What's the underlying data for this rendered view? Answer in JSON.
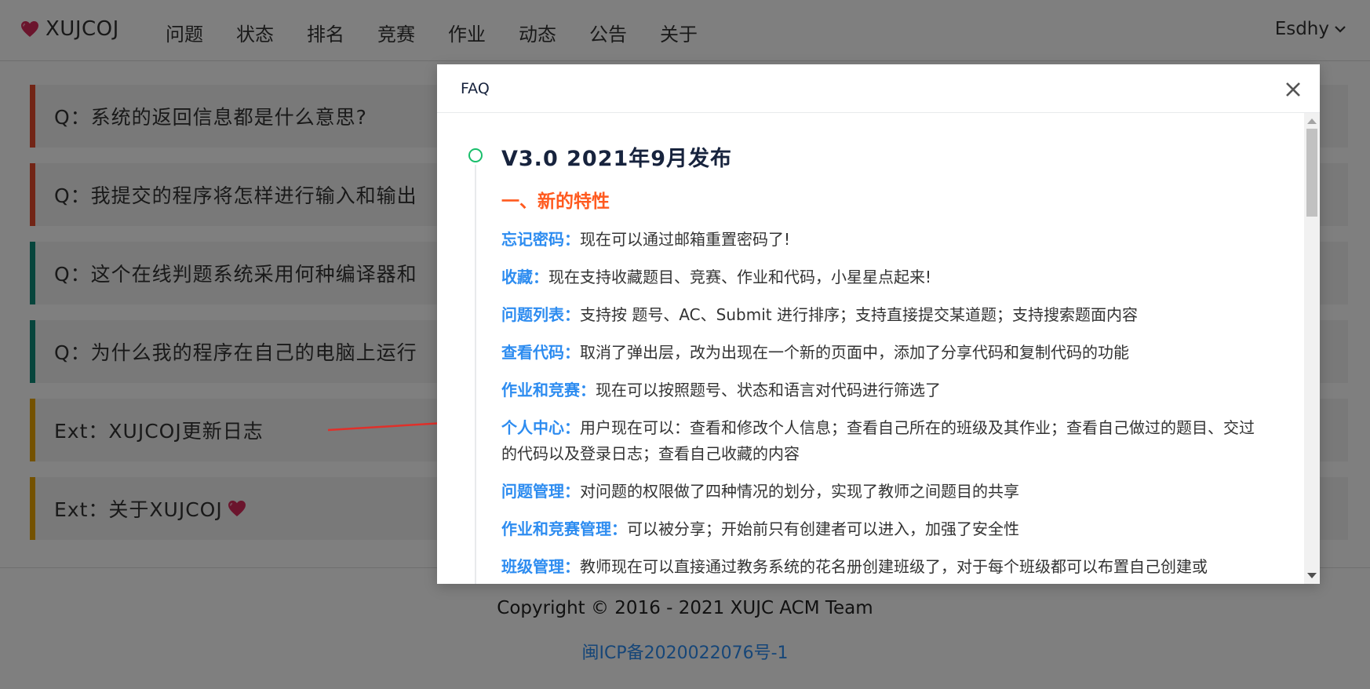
{
  "navbar": {
    "brand": "XUJCOJ",
    "items": [
      "问题",
      "状态",
      "排名",
      "竞赛",
      "作业",
      "动态",
      "公告",
      "关于"
    ],
    "user": "Esdhy"
  },
  "faq_list": {
    "items": [
      {
        "label": "Q：系统的返回信息都是什么意思?",
        "accent": "#e54b2c"
      },
      {
        "label": "Q：我提交的程序将怎样进行输入和输出",
        "accent": "#e54b2c"
      },
      {
        "label": "Q：这个在线判题系统采用何种编译器和",
        "accent": "#0f8a78"
      },
      {
        "label": "Q：为什么我的程序在自己的电脑上运行",
        "accent": "#0f8a78"
      },
      {
        "label": "Ext：XUJCOJ更新日志",
        "accent": "#e8a500"
      },
      {
        "label": "Ext：关于XUJCOJ",
        "accent": "#e8a500"
      }
    ]
  },
  "footer": {
    "copyright": "Copyright © 2016 - 2021 XUJC ACM Team",
    "icp": "闽ICP备2020022076号-1"
  },
  "modal": {
    "title": "FAQ",
    "version_title": "V3.0 2021年9月发布",
    "section_title": "一、新的特性",
    "features": [
      {
        "name": "忘记密码：",
        "desc": "现在可以通过邮箱重置密码了!"
      },
      {
        "name": "收藏：",
        "desc": "现在支持收藏题目、竞赛、作业和代码，小星星点起来!"
      },
      {
        "name": "问题列表：",
        "desc": "支持按 题号、AC、Submit 进行排序；支持直接提交某道题；支持搜索题面内容"
      },
      {
        "name": "查看代码：",
        "desc": "取消了弹出层，改为出现在一个新的页面中，添加了分享代码和复制代码的功能"
      },
      {
        "name": "作业和竞赛：",
        "desc": "现在可以按照题号、状态和语言对代码进行筛选了"
      },
      {
        "name": "个人中心：",
        "desc": "用户现在可以：查看和修改个人信息；查看自己所在的班级及其作业；查看自己做过的题目、交过的代码以及登录日志；查看自己收藏的内容"
      },
      {
        "name": "问题管理：",
        "desc": "对问题的权限做了四种情况的划分，实现了教师之间题目的共享"
      },
      {
        "name": "作业和竞赛管理：",
        "desc": "可以被分享；开始前只有创建者可以进入，加强了安全性"
      },
      {
        "name": "班级管理：",
        "desc": "教师现在可以直接通过教务系统的花名册创建班级了，对于每个班级都可以布置自己创建或"
      }
    ]
  },
  "colors": {
    "timeline_dot": "#19be6b",
    "section_title": "#ff5a1f",
    "feature_name": "#2d8cf0",
    "arrow": "#e0302a"
  },
  "icons": {
    "brand": "heart-icon",
    "user_menu": "chevron-down-icon",
    "close": "close-icon"
  }
}
